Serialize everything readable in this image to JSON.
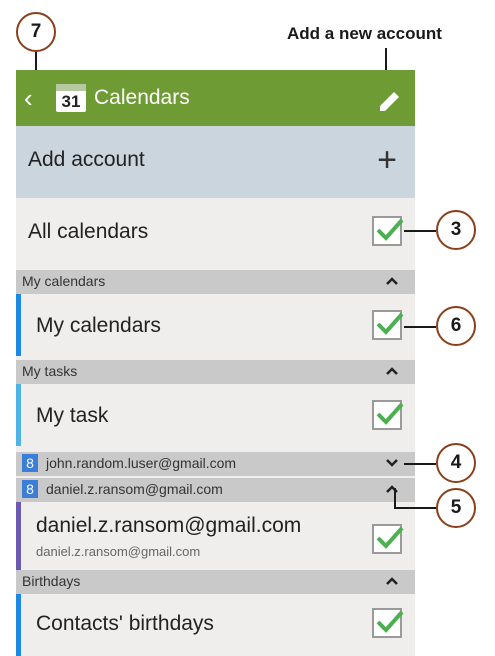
{
  "annotations": {
    "add_new_account": "Add a new account",
    "callouts": [
      "7",
      "3",
      "6",
      "4",
      "5"
    ]
  },
  "appbar": {
    "title": "Calendars",
    "calendar_icon_day": "31",
    "color": "#6e9b33"
  },
  "add_account": {
    "label": "Add account",
    "plus": "+"
  },
  "all_calendars": {
    "label": "All calendars",
    "checked": true
  },
  "sections": {
    "my_calendars_header": "My calendars",
    "my_calendars_item": "My calendars",
    "my_tasks_header": "My tasks",
    "my_tasks_item": "My task",
    "account1_header": "john.random.luser@gmail.com",
    "account2_header": "daniel.z.ransom@gmail.com",
    "account2_item": "daniel.z.ransom@gmail.com",
    "account2_item_sub": "daniel.z.ransom@gmail.com",
    "birthdays_header": "Birthdays",
    "birthdays_item": "Contacts' birthdays"
  },
  "google_icon_letter": "8",
  "colors": {
    "my_calendars_bar": "#1e88e5",
    "my_task_bar": "#4fb3e8",
    "daniel_bar": "#6a5bb0",
    "birthdays_bar": "#1e88e5",
    "check": "#4caf50"
  }
}
